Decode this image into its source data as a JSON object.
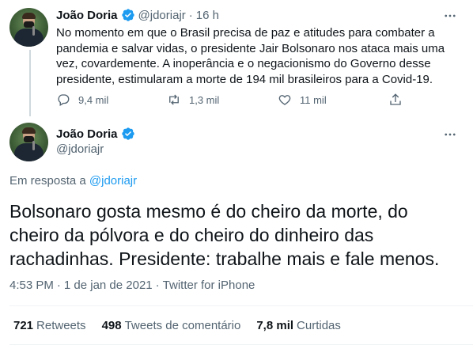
{
  "colors": {
    "accent": "#1d9bf0",
    "text": "#0f1419",
    "muted": "#536471",
    "divider": "#eff3f4"
  },
  "tweet1": {
    "name": "João Doria",
    "handle": "@jdoriajr",
    "time": "16 h",
    "text": "No momento em que o Brasil precisa de paz e atitudes para combater a pandemia e salvar vidas, o presidente Jair Bolsonaro nos ataca mais uma vez, covardemente. A inoperância e o negacionismo do Governo desse presidente, estimularam a morte de 194 mil brasileiros para a Covid-19.",
    "actions": {
      "reply_count": "9,4 mil",
      "retweet_count": "1,3 mil",
      "like_count": "11 mil"
    }
  },
  "tweet2": {
    "name": "João Doria",
    "handle": "@jdoriajr",
    "reply_prefix": "Em resposta a",
    "reply_to": "@jdoriajr",
    "text": "Bolsonaro gosta mesmo é do cheiro da morte, do cheiro da pólvora e do cheiro do dinheiro das rachadinhas. Presidente: trabalhe mais e fale menos.",
    "time": "4:53 PM",
    "separator": "·",
    "date": "1 de jan de 2021",
    "source": "Twitter for iPhone"
  },
  "stats": {
    "retweets_count": "721",
    "retweets_label": "Retweets",
    "comments_count": "498",
    "comments_label": "Tweets de comentário",
    "likes_count": "7,8 mil",
    "likes_label": "Curtidas"
  },
  "icons": [
    "verified-icon",
    "more-icon",
    "reply-icon",
    "retweet-icon",
    "like-icon",
    "share-icon"
  ]
}
